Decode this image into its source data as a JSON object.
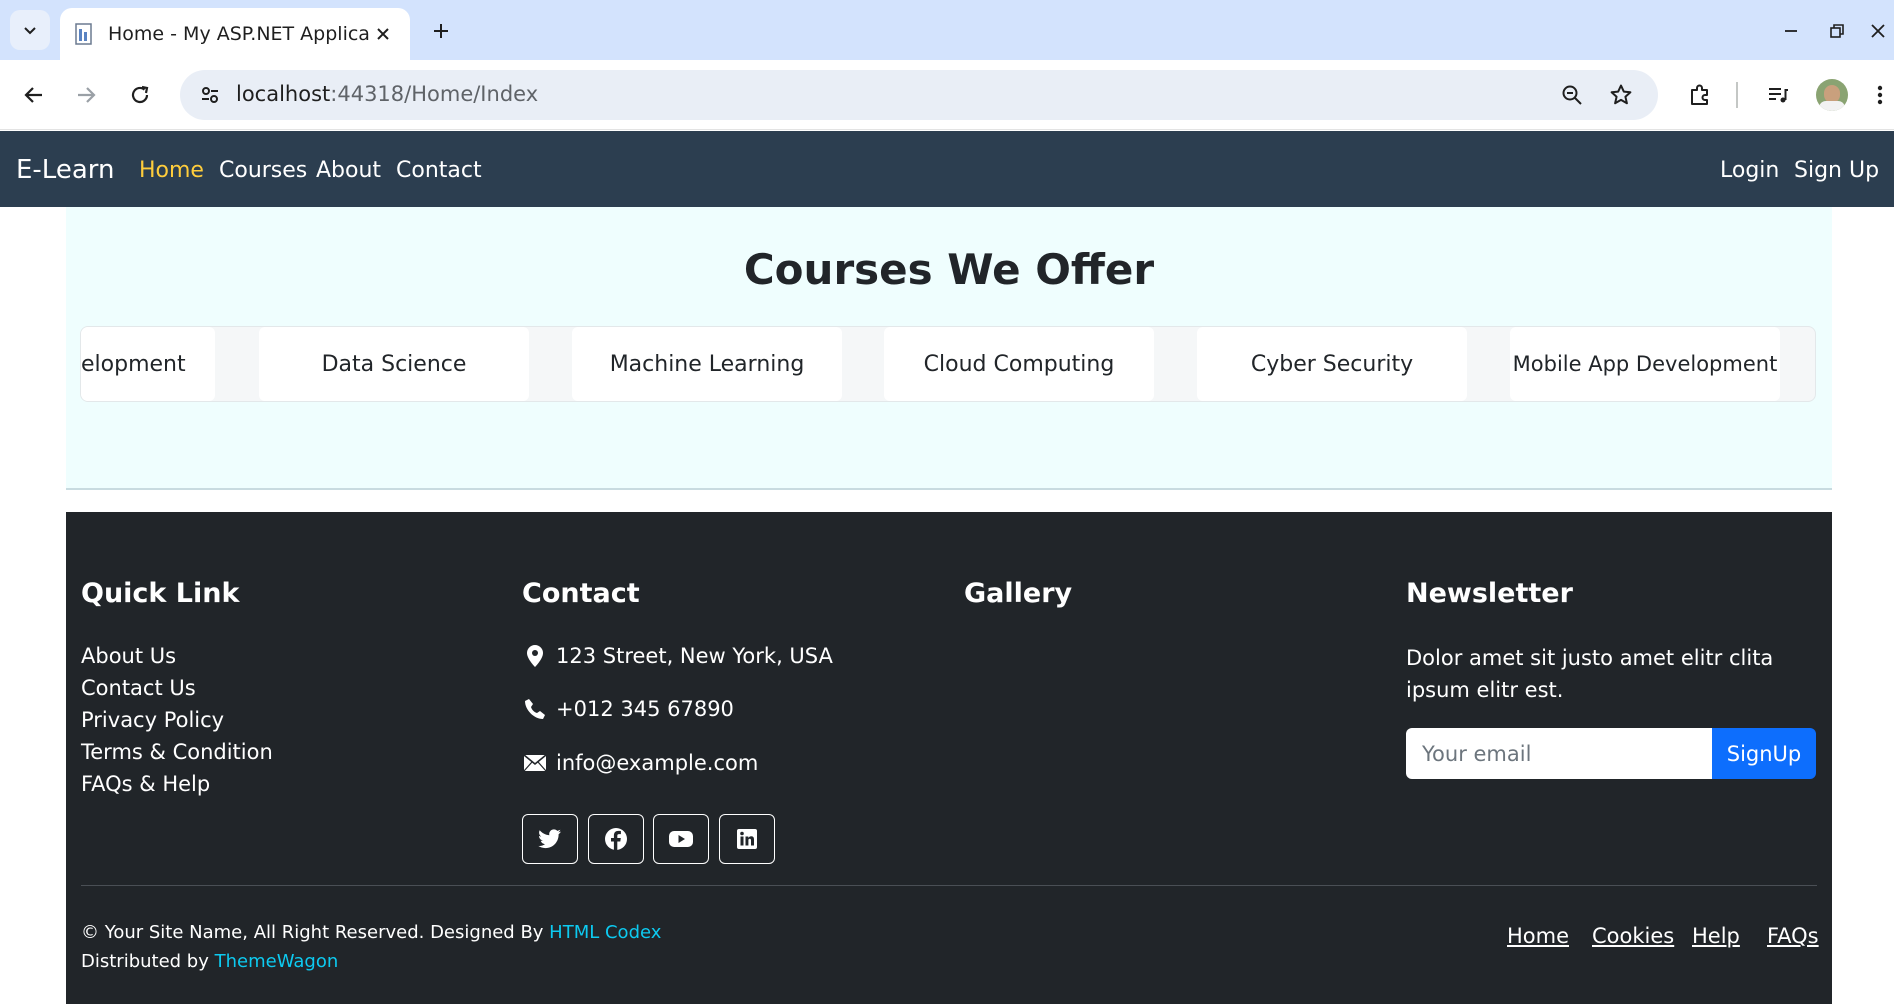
{
  "browser": {
    "tab_title": "Home - My ASP.NET Application",
    "url_host": "localhost",
    "url_path": ":44318/Home/Index"
  },
  "navbar": {
    "brand": "E-Learn",
    "links": [
      "Home",
      "Courses",
      "About",
      "Contact"
    ],
    "active": "Home",
    "login": "Login",
    "signup": "Sign Up"
  },
  "courses": {
    "title": "Courses We Offer",
    "items": [
      "elopment",
      "Data Science",
      "Machine Learning",
      "Cloud Computing",
      "Cyber Security",
      "Mobile App Development"
    ]
  },
  "footer": {
    "quick_link": {
      "heading": "Quick Link",
      "items": [
        "About Us",
        "Contact Us",
        "Privacy Policy",
        "Terms & Condition",
        "FAQs & Help"
      ]
    },
    "contact": {
      "heading": "Contact",
      "address": "123 Street, New York, USA",
      "phone": "+012 345 67890",
      "email": "info@example.com"
    },
    "gallery": {
      "heading": "Gallery"
    },
    "newsletter": {
      "heading": "Newsletter",
      "text": "Dolor amet sit justo amet elitr clita ipsum elitr est.",
      "placeholder": "Your email",
      "button": "SignUp"
    },
    "copyright": {
      "line1_prefix": "© Your Site Name, All Right Reserved. Designed By ",
      "line1_link": "HTML Codex",
      "line2_prefix": "Distributed by ",
      "line2_link": "ThemeWagon"
    },
    "bottom_links": [
      "Home",
      "Cookies",
      "Help",
      "FAQs"
    ]
  },
  "icons": {
    "social": [
      "twitter-icon",
      "facebook-icon",
      "youtube-icon",
      "linkedin-icon"
    ]
  },
  "colors": {
    "navbar_bg": "#2c3e50",
    "active_link": "#ffcd3c",
    "footer_bg": "#212529",
    "accent_blue": "#0d6efd",
    "link_cyan": "#0dcaf0",
    "section_bg": "#effefe"
  }
}
